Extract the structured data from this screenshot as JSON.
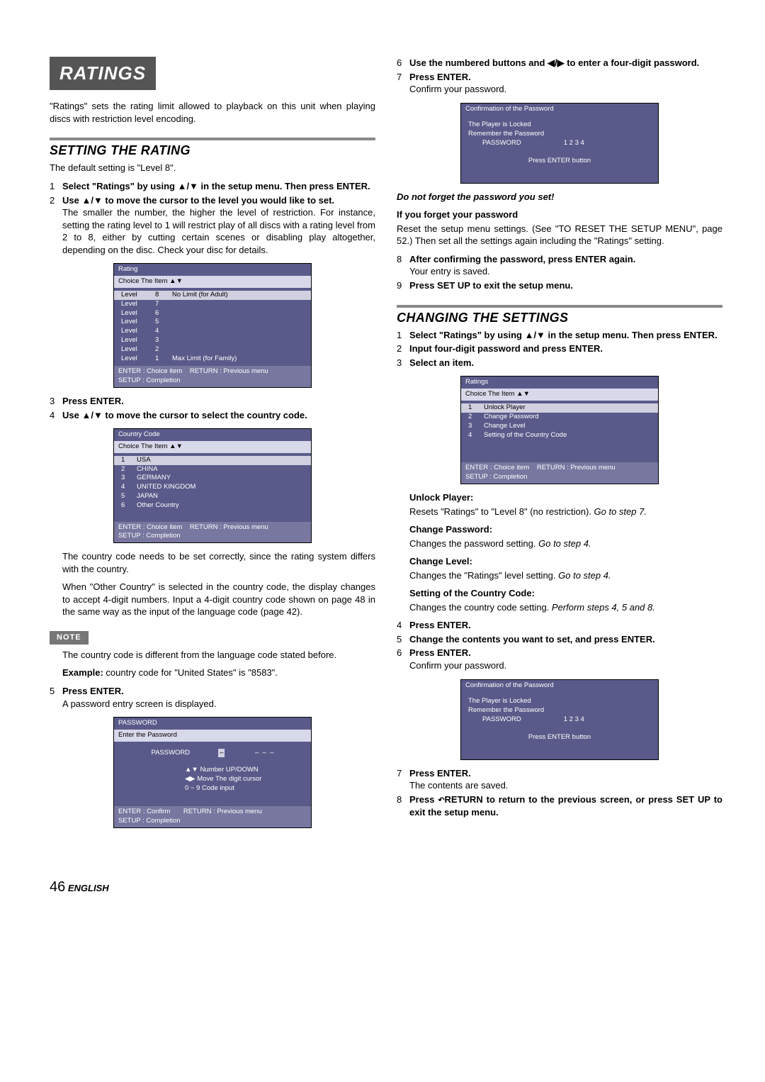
{
  "page": {
    "title": "RATINGS",
    "intro": "\"Ratings\" sets the rating limit allowed to playback on this unit when playing discs with restriction level encoding.",
    "footer_page": "46",
    "footer_lang": "ENGLISH"
  },
  "setting": {
    "title": "SETTING THE RATING",
    "default": "The default setting is \"Level 8\".",
    "step1": "Select \"Ratings\" by using ▲/▼ in the setup menu. Then press ENTER.",
    "step2": "Use ▲/▼ to move the cursor to the level you would like to set.",
    "step2_body": "The smaller the number, the higher the level of restriction. For instance, setting the rating level to 1 will restrict play of all discs with a rating level from 2 to 8, either by cutting certain scenes or disabling play altogether, depending on the disc. Check your disc for details.",
    "step3": "Press ENTER.",
    "step4": "Use ▲/▼ to move the cursor to select the country code.",
    "country_body": "The country code needs to be set correctly, since the rating system differs with the country.",
    "country_body2": "When \"Other Country\" is selected in the country code, the display changes to accept 4-digit numbers. Input a 4-digit country code shown on page 48 in the same way as the input of the language code (page 42).",
    "note_label": "NOTE",
    "note_body": "The country code is different from the language code stated before.",
    "example_label": "Example:",
    "example_body": " country code for \"United States\" is \"8583\".",
    "step5": "Press ENTER.",
    "step5_body": "A password entry screen is displayed."
  },
  "ratingScreen": {
    "title": "Rating",
    "sub": "Choice  The  Item  ▲▼",
    "rows": [
      {
        "lv": "Level",
        "n": "8",
        "txt": "No Limit (for Adult)"
      },
      {
        "lv": "Level",
        "n": "7",
        "txt": ""
      },
      {
        "lv": "Level",
        "n": "6",
        "txt": ""
      },
      {
        "lv": "Level",
        "n": "5",
        "txt": ""
      },
      {
        "lv": "Level",
        "n": "4",
        "txt": ""
      },
      {
        "lv": "Level",
        "n": "3",
        "txt": ""
      },
      {
        "lv": "Level",
        "n": "2",
        "txt": ""
      },
      {
        "lv": "Level",
        "n": "1",
        "txt": "Max Limit (for  Family)"
      }
    ],
    "foot1": "ENTER : Choice  item",
    "foot2": "RETURN : Previous menu",
    "foot3": "SETUP : Completion"
  },
  "countryScreen": {
    "title": "Country  Code",
    "sub": "Choice  The Item  ▲▼",
    "rows": [
      {
        "n": "1",
        "c": "USA"
      },
      {
        "n": "2",
        "c": "CHINA"
      },
      {
        "n": "3",
        "c": "GERMANY"
      },
      {
        "n": "4",
        "c": "UNITED  KINGDOM"
      },
      {
        "n": "5",
        "c": "JAPAN"
      },
      {
        "n": "6",
        "c": "Other Country"
      }
    ],
    "foot1": "ENTER : Choice  item",
    "foot2": "RETURN : Previous menu",
    "foot3": "SETUP : Completion"
  },
  "passwordScreen": {
    "title": "PASSWORD",
    "line1": "Enter  the  Password",
    "pw_label": "PASSWORD",
    "pw_val": "–  –  –  –",
    "h1": "▲▼ Number  UP/DOWN",
    "h2": "◀▶ Move  The  digit cursor",
    "h3": "0 ~ 9  Code  input",
    "foot1": "ENTER : Confirm",
    "foot2": "RETURN : Previous menu",
    "foot3": "SETUP : Completion"
  },
  "right": {
    "step6": "Use the numbered buttons and ◀/▶ to enter a four-digit password.",
    "step7": "Press ENTER.",
    "step7_body": "Confirm your password.",
    "warn": "Do not forget the password you set!",
    "forget_head": "If you forget your password",
    "forget_body": "Reset the setup menu settings.  (See \"TO RESET THE SETUP MENU\", page 52.)  Then set all the settings again including the \"Ratings\" setting.",
    "step8": "After confirming the password, press ENTER again.",
    "step8_body": "Your entry is saved.",
    "step9": "Press SET UP to exit the setup menu."
  },
  "confirmScreen": {
    "title": "Confirmation  of  the  Password",
    "l1": "The  Player  is  Locked",
    "l2": "Remember  the  Password",
    "pw_label": "PASSWORD",
    "pw_val": "1  2  3  4",
    "btn": "Press ENTER  button"
  },
  "changing": {
    "title": "CHANGING THE SETTINGS",
    "step1": "Select \"Ratings\" by using ▲/▼ in the setup menu. Then press ENTER.",
    "step2": "Input four-digit password and press ENTER.",
    "step3": "Select an item.",
    "unlock_head": "Unlock Player:",
    "unlock_body": "Resets \"Ratings\" to \"Level 8\" (no restriction). ",
    "unlock_goto": "Go to step 7.",
    "cp_head": "Change Password:",
    "cp_body": "Changes the password setting. ",
    "cp_goto": "Go to step 4.",
    "cl_head": "Change Level:",
    "cl_body": "Changes the \"Ratings\" level setting. ",
    "cl_goto": "Go to step 4.",
    "cc_head": "Setting of the Country Code:",
    "cc_body": "Changes the country code setting. ",
    "cc_goto": "Perform steps 4, 5 and 8.",
    "step4": "Press ENTER.",
    "step5": "Change the contents you want to set, and press ENTER.",
    "step6": "Press ENTER.",
    "step6_body": "Confirm your password.",
    "step7": "Press ENTER.",
    "step7_body": "The contents are saved.",
    "step8a": "Press ",
    "step8b": "RETURN to return to the previous screen, or press SET UP to exit the setup menu."
  },
  "ratingsMenuScreen": {
    "title": "Ratings",
    "sub": "Choice  The Item  ▲▼",
    "rows": [
      {
        "n": "1",
        "c": "Unlock  Player"
      },
      {
        "n": "2",
        "c": "Change  Password"
      },
      {
        "n": "3",
        "c": "Change  Level"
      },
      {
        "n": "4",
        "c": "Setting  of  the  Country  Code"
      }
    ],
    "foot1": "ENTER : Choice  item",
    "foot2": "RETURN : Previous menu",
    "foot3": "SETUP : Completion"
  }
}
